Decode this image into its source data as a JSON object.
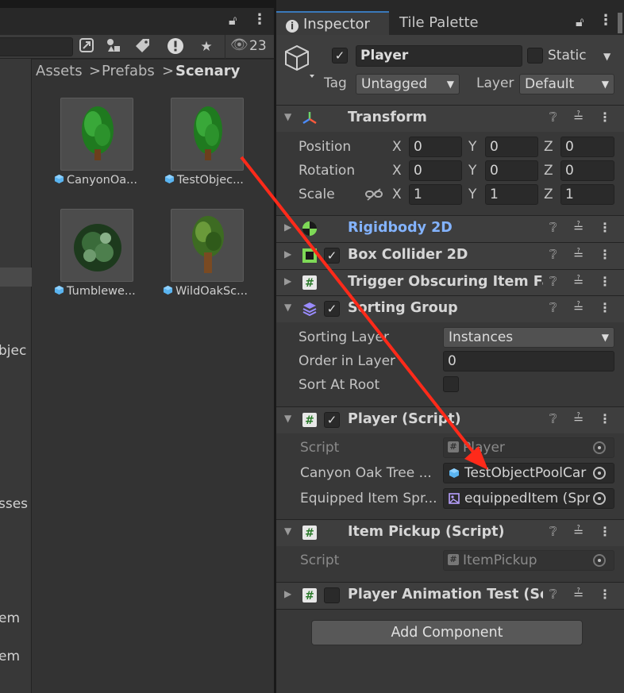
{
  "left_strip": {
    "items": [
      "bjec",
      "sses",
      "em",
      "em"
    ]
  },
  "project": {
    "visibility_count": "23",
    "breadcrumb": {
      "part1": "Assets",
      "sep": ">",
      "part2": "Prefabs",
      "current": "Scenary"
    },
    "assets": [
      {
        "label": "CanyonOa..."
      },
      {
        "label": "TestObjec..."
      },
      {
        "label": "Tumblewe..."
      },
      {
        "label": "WildOakSc..."
      }
    ]
  },
  "inspector": {
    "tabs": {
      "inspector": "Inspector",
      "tile_palette": "Tile Palette"
    },
    "object": {
      "name": "Player",
      "static_label": "Static",
      "tag_label": "Tag",
      "tag_value": "Untagged",
      "layer_label": "Layer",
      "layer_value": "Default"
    },
    "transform": {
      "title": "Transform",
      "position_label": "Position",
      "rotation_label": "Rotation",
      "scale_label": "Scale",
      "axis_x": "X",
      "axis_y": "Y",
      "axis_z": "Z",
      "position": {
        "x": "0",
        "y": "0",
        "z": "0"
      },
      "rotation": {
        "x": "0",
        "y": "0",
        "z": "0"
      },
      "scale": {
        "x": "1",
        "y": "1",
        "z": "1"
      }
    },
    "rigidbody": {
      "title": "Rigidbody 2D"
    },
    "box_collider": {
      "title": "Box Collider 2D"
    },
    "trigger": {
      "title": "Trigger Obscuring Item Fa"
    },
    "sorting_group": {
      "title": "Sorting Group",
      "sorting_layer_label": "Sorting Layer",
      "sorting_layer_value": "Instances",
      "order_label": "Order in Layer",
      "order_value": "0",
      "sort_at_root_label": "Sort At Root"
    },
    "player_script": {
      "title": "Player (Script)",
      "script_label": "Script",
      "script_value": "Player",
      "canyon_label": "Canyon Oak Tree ...",
      "canyon_value": "TestObjectPoolCar",
      "equipped_label": "Equipped Item Spr...",
      "equipped_value": "equippedItem (Spri"
    },
    "item_pickup": {
      "title": "Item Pickup (Script)",
      "script_label": "Script",
      "script_value": "ItemPickup"
    },
    "player_anim": {
      "title": "Player Animation Test (Scr"
    },
    "add_component": "Add Component"
  },
  "colors": {
    "accent_blue": "#3a79bb",
    "rigidbody_title": "#83b3ff",
    "annotation_arrow": "#ff2a1a"
  }
}
